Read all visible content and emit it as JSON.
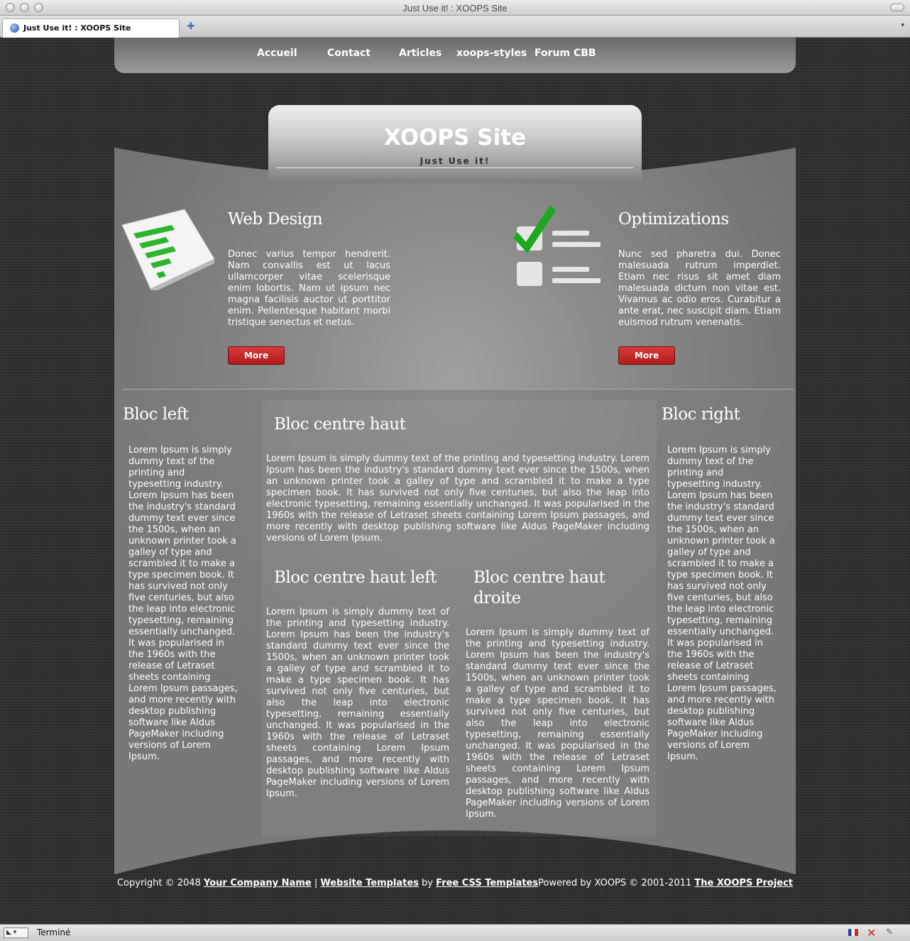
{
  "window": {
    "title": "Just Use it! : XOOPS Site"
  },
  "tab": {
    "label": "Just Use it! : XOOPS Site"
  },
  "nav": {
    "items": [
      "Accueil",
      "Contact",
      "Articles",
      "xoops-styles",
      "Forum CBB"
    ]
  },
  "header": {
    "title": "XOOPS Site",
    "slogan": "Just Use it!"
  },
  "features": [
    {
      "title": "Web Design",
      "text": "Donec varius tempor hendrerit. Nam convallis est ut lacus ullamcorper vitae scelerisque enim lobortis. Nam ut ipsum nec magna facilisis auctor ut porttitor enim. Pellentesque habitant morbi tristique senectus et netus.",
      "button": "More",
      "icon": "spreadsheet-icon"
    },
    {
      "title": "Optimizations",
      "text": "Nunc sed pharetra dui. Donec malesuada rutrum imperdiet. Etiam nec risus sit amet diam malesuada dictum non vitae est. Vivamus ac odio eros. Curabitur a ante erat, nec suscipit diam. Etiam euismod rutrum venenatis.",
      "button": "More",
      "icon": "checklist-icon"
    }
  ],
  "blocks": {
    "left": {
      "title": "Bloc left",
      "text": "Lorem Ipsum is simply dummy text of the printing and typesetting industry. Lorem Ipsum has been the industry's standard dummy text ever since the 1500s, when an unknown printer took a galley of type and scrambled it to make a type specimen book. It has survived not only five centuries, but also the leap into electronic typesetting, remaining essentially unchanged. It was popularised in the 1960s with the release of Letraset sheets containing Lorem Ipsum passages, and more recently with desktop publishing software like Aldus PageMaker including versions of Lorem Ipsum."
    },
    "center_top": {
      "title": "Bloc centre haut",
      "text": "Lorem Ipsum is simply dummy text of the printing and typesetting industry. Lorem Ipsum has been the industry's standard dummy text ever since the 1500s, when an unknown printer took a galley of type and scrambled it to make a type specimen book. It has survived not only five centuries, but also the leap into electronic typesetting, remaining essentially unchanged. It was popularised in the 1960s with the release of Letraset sheets containing Lorem Ipsum passages, and more recently with desktop publishing software like Aldus PageMaker including versions of Lorem Ipsum."
    },
    "center_left": {
      "title": "Bloc centre haut left",
      "text": "Lorem Ipsum is simply dummy text of the printing and typesetting industry. Lorem Ipsum has been the industry's standard dummy text ever since the 1500s, when an unknown printer took a galley of type and scrambled it to make a type specimen book. It has survived not only five centuries, but also the leap into electronic typesetting, remaining essentially unchanged. It was popularised in the 1960s with the release of Letraset sheets containing Lorem Ipsum passages, and more recently with desktop publishing software like Aldus PageMaker including versions of Lorem Ipsum."
    },
    "center_right": {
      "title": "Bloc centre haut droite",
      "text": "Lorem Ipsum is simply dummy text of the printing and typesetting industry. Lorem Ipsum has been the industry's standard dummy text ever since the 1500s, when an unknown printer took a galley of type and scrambled it to make a type specimen book. It has survived not only five centuries, but also the leap into electronic typesetting, remaining essentially unchanged. It was popularised in the 1960s with the release of Letraset sheets containing Lorem Ipsum passages, and more recently with desktop publishing software like Aldus PageMaker including versions of Lorem Ipsum."
    },
    "right": {
      "title": "Bloc right",
      "text": "Lorem Ipsum is simply dummy text of the printing and typesetting industry. Lorem Ipsum has been the industry's standard dummy text ever since the 1500s, when an unknown printer took a galley of type and scrambled it to make a type specimen book. It has survived not only five centuries, but also the leap into electronic typesetting, remaining essentially unchanged. It was popularised in the 1960s with the release of Letraset sheets containing Lorem Ipsum passages, and more recently with desktop publishing software like Aldus PageMaker including versions of Lorem Ipsum."
    }
  },
  "footer": {
    "copyright": "Copyright © 2048 ",
    "company_link": "Your Company Name",
    "sep": " | ",
    "templates_link": "Website Templates",
    "by": " by ",
    "css_link": "Free CSS Templates",
    "powered": "Powered by XOOPS © 2001-2011 ",
    "xoops_link": "The XOOPS Project"
  },
  "status": {
    "text": "Terminé"
  },
  "colors": {
    "accent_button": "#c62828",
    "panel": "#7a7a7a",
    "background": "#2c2c2c"
  }
}
